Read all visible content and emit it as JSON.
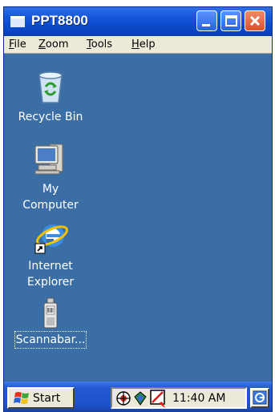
{
  "window": {
    "title": "PPT8800"
  },
  "menu": {
    "file": {
      "mnemonic": "F",
      "rest": "ile"
    },
    "zoom": {
      "mnemonic": "Z",
      "rest": "oom"
    },
    "tools": {
      "mnemonic": "T",
      "rest": "ools"
    },
    "help": {
      "mnemonic": "H",
      "rest": "elp"
    }
  },
  "desktop": {
    "icons": [
      {
        "label_lines": [
          "Recycle Bin"
        ],
        "icon": "recycle-bin-icon"
      },
      {
        "label_lines": [
          "My",
          "Computer"
        ],
        "icon": "computer-icon"
      },
      {
        "label_lines": [
          "Internet",
          "Explorer"
        ],
        "icon": "internet-explorer-icon"
      },
      {
        "label_lines": [
          "Scannabar..."
        ],
        "icon": "scanner-app-icon",
        "selected": true
      }
    ]
  },
  "taskbar": {
    "start_label": "Start",
    "clock": "11:40 AM",
    "tray_icons": [
      "network-icon",
      "sync-icon",
      "pen-input-icon"
    ]
  },
  "colors": {
    "desktop": "#3a6ea5",
    "titlebar": "#1457d9",
    "menubar": "#ece9d8",
    "taskbar": "#1e4fc8"
  }
}
